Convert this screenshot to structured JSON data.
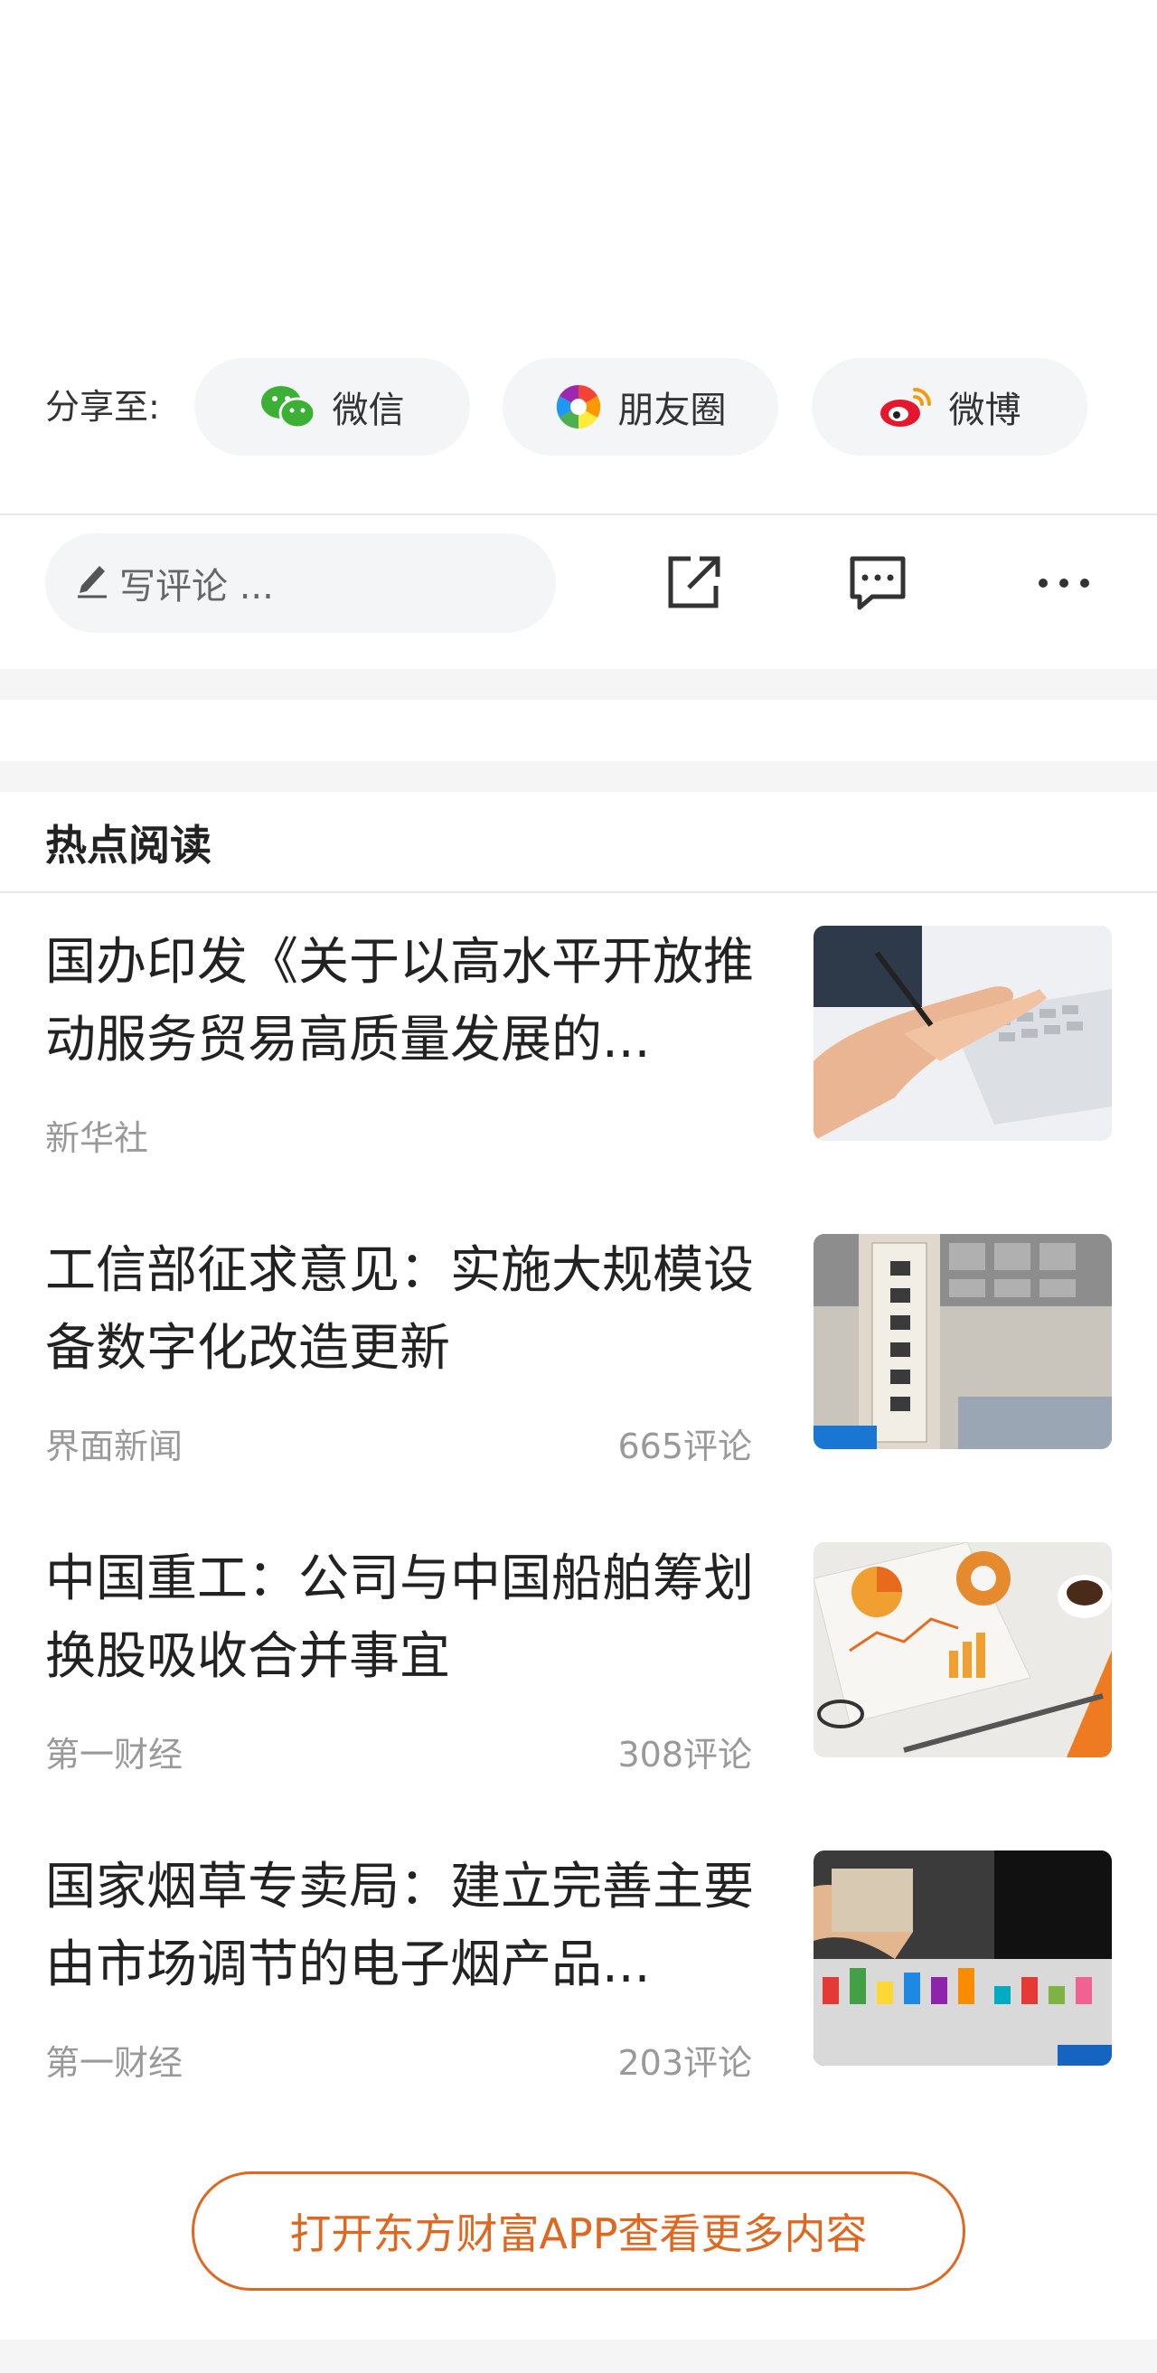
{
  "share": {
    "label": "分享至:",
    "options": [
      {
        "label": "微信",
        "icon": "wechat-icon"
      },
      {
        "label": "朋友圈",
        "icon": "moments-icon"
      },
      {
        "label": "微博",
        "icon": "weibo-icon"
      }
    ]
  },
  "toolbar": {
    "comment_placeholder": "写评论 ...",
    "icons": [
      "share-external-icon",
      "comment-bubble-icon",
      "more-icon"
    ]
  },
  "hot_reading": {
    "title": "热点阅读",
    "items": [
      {
        "title": "国办印发《关于以高水平开放推动服务贸易高质量发展的...",
        "source": "新华社",
        "comments": ""
      },
      {
        "title": "工信部征求意见：实施大规模设备数字化改造更新",
        "source": "界面新闻",
        "comments": "665评论"
      },
      {
        "title": "中国重工：公司与中国船舶筹划换股吸收合并事宜",
        "source": "第一财经",
        "comments": "308评论"
      },
      {
        "title": "国家烟草专卖局：建立完善主要由市场调节的电子烟产品...",
        "source": "第一财经",
        "comments": "203评论"
      }
    ]
  },
  "open_app_label": "打开东方财富APP查看更多内容",
  "colors": {
    "accent": "#e0671f",
    "wechat": "#3cb034",
    "weibo": "#e6162d"
  }
}
